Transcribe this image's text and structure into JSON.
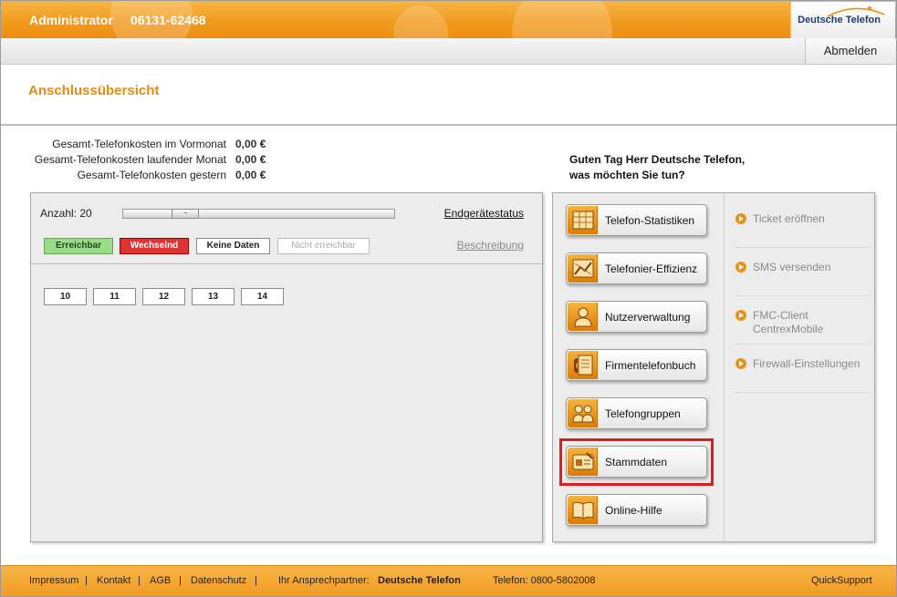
{
  "header": {
    "user": "Administrator",
    "phone": "06131-62468",
    "logo": "Deutsche Telefon",
    "logout_label": "Abmelden"
  },
  "page": {
    "title": "Anschlussübersicht"
  },
  "costs": [
    {
      "label": "Gesamt-Telefonkosten im Vormonat",
      "value": "0,00",
      "currency": "€"
    },
    {
      "label": "Gesamt-Telefonkosten laufender Monat",
      "value": "0,00",
      "currency": "€"
    },
    {
      "label": "Gesamt-Telefonkosten gestern",
      "value": "0,00",
      "currency": "€"
    }
  ],
  "greeting": {
    "line1": "Guten Tag Herr Deutsche Telefon,",
    "line2": "was möchten Sie tun?"
  },
  "devices": {
    "count_label": "Anzahl: 20",
    "slider_fraction": 0.2,
    "status_link": "Endgerätestatus",
    "description_link": "Beschreibung",
    "legend": {
      "reachable": "Erreichbar",
      "changing": "Wechselnd",
      "no_data": "Keine Daten",
      "unreachable": "Nicht erreichbar"
    },
    "extensions": [
      "10",
      "11",
      "12",
      "13",
      "14"
    ]
  },
  "actions": [
    {
      "label": "Telefon-Statistiken",
      "icon": "statistics-icon"
    },
    {
      "label": "Telefonier-Effizienz",
      "icon": "efficiency-chart-icon"
    },
    {
      "label": "Nutzerverwaltung",
      "icon": "user-icon"
    },
    {
      "label": "Firmentelefonbuch",
      "icon": "phonebook-icon"
    },
    {
      "label": "Telefongruppen",
      "icon": "group-icon"
    },
    {
      "label": "Stammdaten",
      "icon": "id-card-icon"
    },
    {
      "label": "Online-Hilfe",
      "icon": "book-icon"
    }
  ],
  "side_links": [
    {
      "line1": "Ticket eröffnen",
      "line2": ""
    },
    {
      "line1": "SMS versenden",
      "line2": ""
    },
    {
      "line1": "FMC-Client",
      "line2": "CentrexMobile"
    },
    {
      "line1": "Firewall-Einstellungen",
      "line2": ""
    }
  ],
  "footer": {
    "impressum": "Impressum",
    "kontakt": "Kontakt",
    "agb": "AGB",
    "datenschutz": "Datenschutz",
    "sep": "|",
    "partner_label": "Ihr Ansprechpartner:",
    "partner_name": "Deutsche Telefon",
    "telefon": "Telefon: 0800-5802008",
    "quicksupport": "QuickSupport"
  },
  "colors": {
    "accent": "#f19a1e",
    "title": "#e88a10",
    "reachable": "#99dd88",
    "changing": "#dd3333",
    "highlight": "#e01b1b"
  }
}
